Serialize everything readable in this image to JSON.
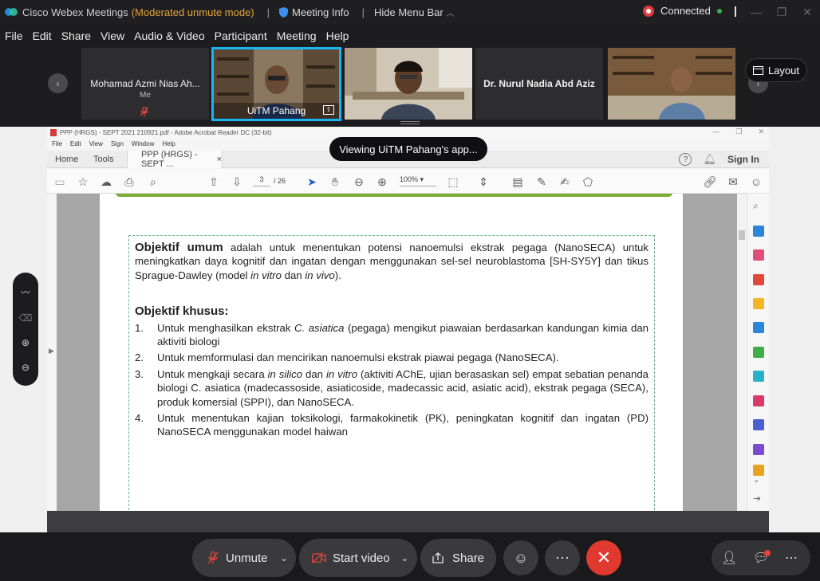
{
  "window": {
    "app_title": "Cisco Webex Meetings",
    "mode": "(Moderated unmute mode)",
    "separator": "|",
    "meeting_info": "Meeting Info",
    "hide_menu_bar": "Hide Menu Bar",
    "connection_status": "Connected"
  },
  "menu": [
    "File",
    "Edit",
    "Share",
    "View",
    "Audio & Video",
    "Participant",
    "Meeting",
    "Help"
  ],
  "participants": [
    {
      "name": "Mohamad Azmi Nias Ah...",
      "sub": "Me"
    },
    {
      "name": "UiTM Pahang"
    },
    {
      "name": ""
    },
    {
      "name": "Dr. Nurul Nadia Abd Aziz"
    },
    {
      "name": ""
    }
  ],
  "layout_button": "Layout",
  "viewing_badge": "Viewing UiTM Pahang's app...",
  "acrobat": {
    "window_title": "PPP (HRGS) - SEPT 2021 210921.pdf - Adobe Acrobat Reader DC (32-bit)",
    "menus": [
      "File",
      "Edit",
      "View",
      "Sign",
      "Window",
      "Help"
    ],
    "tabs": {
      "home": "Home",
      "tools": "Tools",
      "doc": "PPP (HRGS) - SEPT ...",
      "close": "×",
      "sign_in": "Sign In"
    },
    "page_current": "3",
    "page_total": "/ 26",
    "zoom": "100%"
  },
  "document": {
    "general_heading": "Objektif umum",
    "general_text_1": " adalah untuk menentukan potensi nanoemulsi ekstrak pegaga (NanoSECA) untuk meningkatkan daya kognitif dan ingatan dengan menggunakan sel-sel neuroblastoma [SH-SY5Y] dan tikus Sprague-Dawley (model ",
    "in_vitro": "in vitro",
    "dan": " dan ",
    "in_vivo": "in vivo",
    "close_paren": ").",
    "specific_heading": "Objektif khusus:",
    "items": [
      {
        "num": "1.",
        "a": "Untuk menghasilkan ekstrak ",
        "i": "C. asiatica",
        "b": " (pegaga) mengikut piawaian berdasarkan kandungan kimia dan aktiviti biologi"
      },
      {
        "num": "2.",
        "a": "Untuk memformulasi dan mencirikan nanoemulsi ekstrak piawai pegaga (NanoSECA).",
        "i": "",
        "b": ""
      },
      {
        "num": "3.",
        "a": "Untuk mengkaji secara ",
        "i": "in silico",
        "b": " dan ",
        "i2": "in vitro",
        "c": " (aktiviti AChE, ujian berasaskan sel) empat sebatian penanda biologi  C. asiatica (madecassoside, asiaticoside, madecassic acid, asiatic acid), ekstrak pegaga (SECA), produk komersial (SPPI), dan NanoSECA."
      },
      {
        "num": "4.",
        "a": "Untuk menentukan kajian toksikologi, farmakokinetik (PK), peningkatan kognitif dan ingatan (PD) NanoSECA menggunakan model haiwan",
        "i": "",
        "b": ""
      }
    ]
  },
  "controls": {
    "unmute": "Unmute",
    "start_video": "Start video",
    "share": "Share",
    "more": "⋯"
  },
  "colors": {
    "accent": "#16b7f5",
    "end_call": "#e0392f",
    "mode_text": "#e4a23a",
    "border_green": "#68b088"
  }
}
